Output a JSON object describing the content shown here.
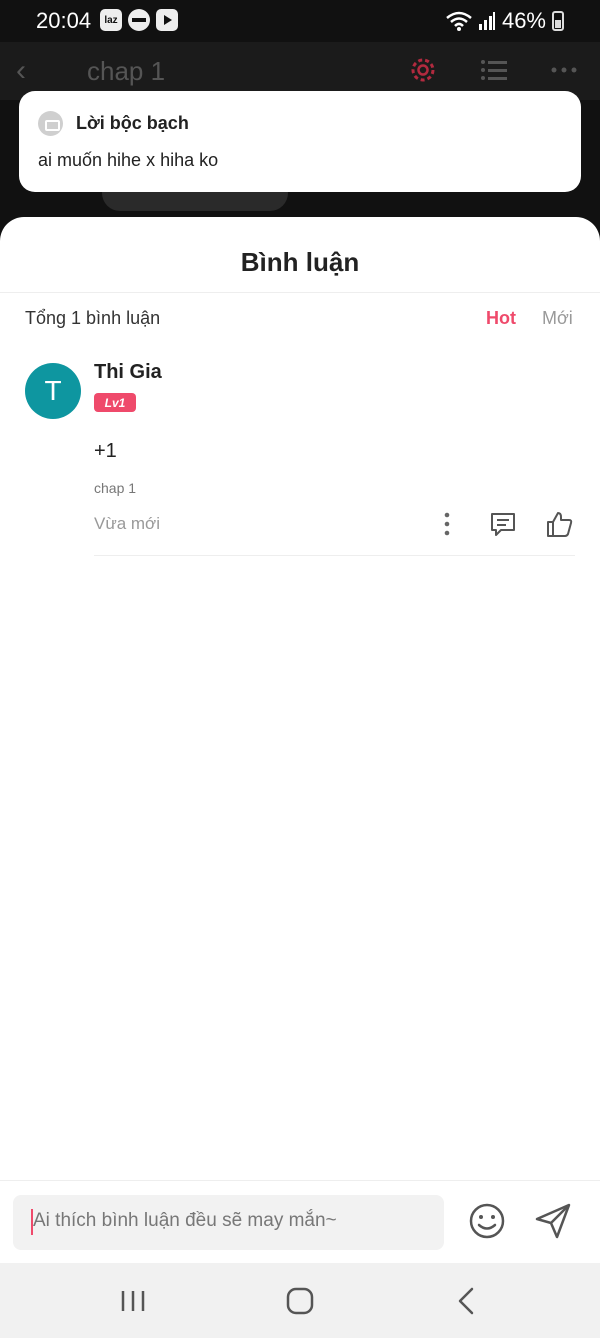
{
  "status": {
    "time": "20:04",
    "battery": "46%",
    "left_icons": [
      "laz",
      "minus-circle-icon",
      "video-icon"
    ]
  },
  "topbar": {
    "title": "chap 1",
    "accent": "#ef4a6b"
  },
  "note": {
    "title": "Lời bộc bạch",
    "text": "ai muốn hihe x hiha ko"
  },
  "sheet": {
    "title": "Bình luận",
    "total": "Tổng 1 bình luận",
    "tabs": [
      {
        "label": "Hot",
        "active": true
      },
      {
        "label": "Mới",
        "active": false
      }
    ]
  },
  "comments": [
    {
      "avatar_letter": "T",
      "avatar_color": "#0e96a0",
      "user": "Thi Gia",
      "level": "Lv1",
      "text": "+1",
      "chapter": "chap 1",
      "time": "Vừa mới"
    }
  ],
  "composer": {
    "placeholder": "Ai thích bình luận đều sẽ may mắn~"
  }
}
